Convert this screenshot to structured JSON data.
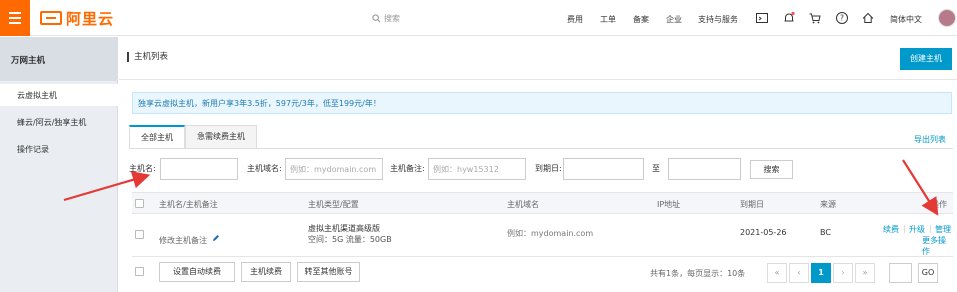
{
  "topbar": {
    "logo_text": "阿里云",
    "search_placeholder": "搜索",
    "nav": [
      "费用",
      "工单",
      "备案",
      "企业",
      "支持与服务"
    ],
    "lang": "简体中文",
    "accent": "#ff6a00"
  },
  "sidebar": {
    "title": "万网主机",
    "items": [
      {
        "label": "云虚拟主机",
        "active": true
      },
      {
        "label": "蜂云/阿云/独享主机",
        "active": false
      },
      {
        "label": "操作记录",
        "active": false
      }
    ]
  },
  "main": {
    "page_title": "主机列表",
    "create_button": "创建主机",
    "notice": "独享云虚拟主机，新用户享3年3.5折，597元/3年，低至199元/年！",
    "tabs": [
      {
        "label": "全部主机",
        "active": true
      },
      {
        "label": "急需续费主机",
        "active": false
      }
    ],
    "export_label": "导出列表",
    "filters": {
      "host_name_label": "主机名:",
      "host_name_value": "",
      "domain_label": "主机域名:",
      "domain_placeholder": "例如：mydomain.com",
      "remark_label": "主机备注:",
      "remark_placeholder": "例如：hyw15312",
      "expiry_label": "到期日:",
      "to_label": "至",
      "search_button": "搜索"
    },
    "table": {
      "headers": [
        "主机名/主机备注",
        "主机类型/配置",
        "主机域名",
        "IP地址",
        "到期日",
        "来源",
        "操作"
      ],
      "rows": [
        {
          "remark": "修改主机备注",
          "type": "虚拟主机渠道高级版",
          "config": "空间：5G 流量：50GB",
          "domain": "例如：mydomain.com",
          "ip": "",
          "expiry": "2021-05-26",
          "source": "BC",
          "actions": {
            "renew": "续费",
            "upgrade": "升级",
            "manage": "管理",
            "more": "更多操作"
          }
        }
      ]
    },
    "footer": {
      "buttons": [
        "设置自动续费",
        "主机续费",
        "转至其他账号"
      ],
      "summary": "共有1条，每页显示：10条",
      "pager": [
        "«",
        "‹",
        "1",
        "›",
        "»"
      ],
      "current_page": "1",
      "go_value": "",
      "go_label": "GO"
    }
  }
}
